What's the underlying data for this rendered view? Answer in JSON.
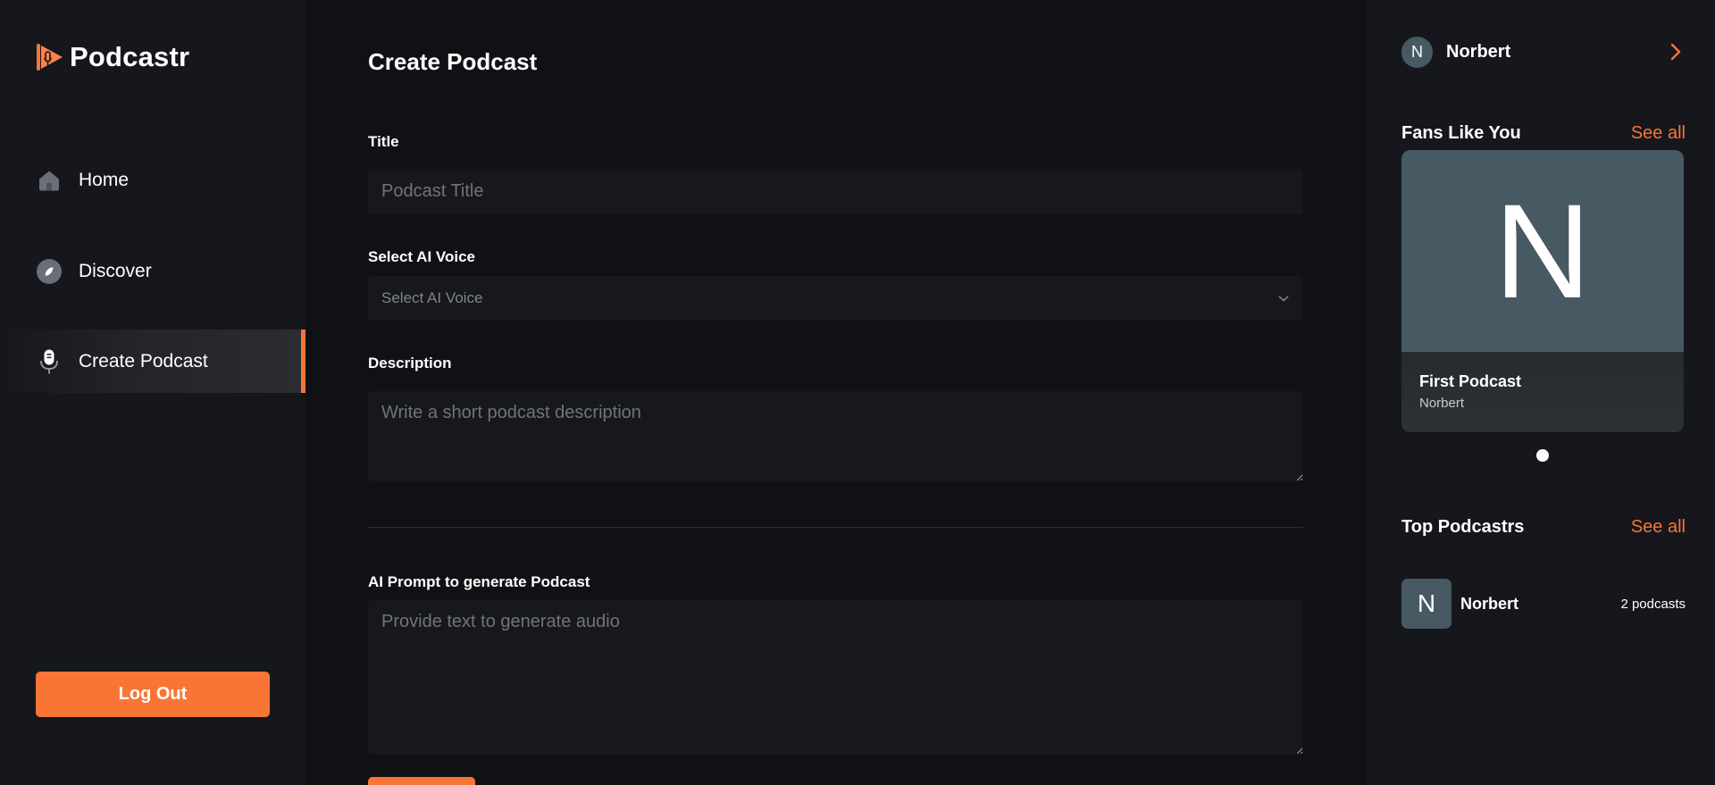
{
  "brand": {
    "name": "Podcastr",
    "accent": "#f97535"
  },
  "sidebar": {
    "items": [
      {
        "label": "Home",
        "icon": "home-icon",
        "active": false
      },
      {
        "label": "Discover",
        "icon": "compass-icon",
        "active": false
      },
      {
        "label": "Create Podcast",
        "icon": "microphone-icon",
        "active": true
      }
    ],
    "logout_label": "Log Out"
  },
  "main": {
    "title": "Create Podcast",
    "fields": {
      "title": {
        "label": "Title",
        "placeholder": "Podcast Title",
        "value": ""
      },
      "voice": {
        "label": "Select AI Voice",
        "placeholder": "Select AI Voice"
      },
      "description": {
        "label": "Description",
        "placeholder": "Write a short podcast description",
        "value": ""
      },
      "prompt": {
        "label": "AI Prompt to generate Podcast",
        "placeholder": "Provide text to generate audio",
        "value": ""
      }
    }
  },
  "rightbar": {
    "user": {
      "initial": "N",
      "name": "Norbert"
    },
    "fans": {
      "title": "Fans Like You",
      "see_all": "See all",
      "card": {
        "initial": "N",
        "title": "First Podcast",
        "author": "Norbert"
      }
    },
    "top": {
      "title": "Top Podcastrs",
      "see_all": "See all",
      "items": [
        {
          "initial": "N",
          "name": "Norbert",
          "count": "2 podcasts"
        }
      ]
    }
  }
}
